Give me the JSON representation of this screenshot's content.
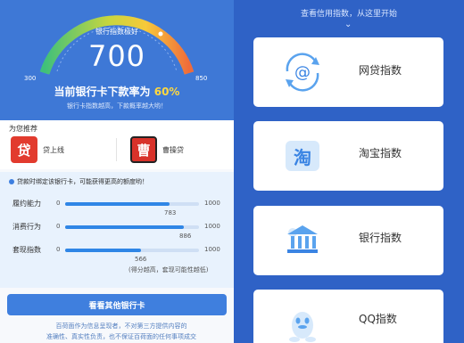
{
  "gauge": {
    "label": "银行指数极好",
    "score": "700",
    "min": "300",
    "max": "850",
    "rate_prefix": "当前银行卡下款率为",
    "rate_value": "60%",
    "subtitle": "银行卡指数越高，下款概率越大哟！"
  },
  "recommend": {
    "title": "为您推荐",
    "apps": [
      {
        "name": "贷上线",
        "icon": "dai-app-icon",
        "glyph": "贷"
      },
      {
        "name": "曹操贷",
        "icon": "caocao-app-icon",
        "glyph": "曹"
      }
    ]
  },
  "bind": {
    "tip": "贷款时绑定该银行卡，可能获得更高的额度哟！",
    "metrics": [
      {
        "label": "履约能力",
        "min": "0",
        "max": "1000",
        "value": "783",
        "fraction": 0.783
      },
      {
        "label": "消费行为",
        "min": "0",
        "max": "1000",
        "value": "886",
        "fraction": 0.886
      },
      {
        "label": "套现指数",
        "min": "0",
        "max": "1000",
        "value": "566",
        "fraction": 0.566
      }
    ],
    "note": "(得分越高，套现可能性越低)"
  },
  "button": {
    "label": "看看其他银行卡"
  },
  "disclaimer": [
    "百荷面作为信息呈现者，不对第三方提供内容的",
    "准确性、真实性负责，也不保证百荷面的任何事项成交"
  ],
  "right": {
    "header": "查看信用指数，从这里开始",
    "cards": [
      {
        "name": "网贷指数",
        "icon": "at-sign-icon"
      },
      {
        "name": "淘宝指数",
        "icon": "taobao-icon"
      },
      {
        "name": "银行指数",
        "icon": "bank-icon"
      },
      {
        "name": "QQ指数",
        "icon": "qq-penguin-icon"
      }
    ]
  },
  "colors": {
    "brand_blue": "#3e78d6",
    "right_bg": "#2f62c6",
    "accent_yellow": "#ffd83f",
    "bar_fill": "#2f86e6"
  }
}
